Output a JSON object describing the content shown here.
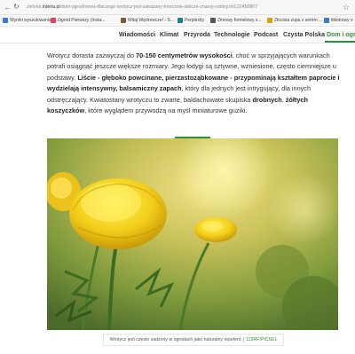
{
  "browser": {
    "url_prefix": "zielona.",
    "url_domain": "interia.pl",
    "url_path": "/dom-ogrod/news-dlaczego-wrotycz-jest-zakazany-mrocznie-oblicze-znanej-rosliny,nId,22450867"
  },
  "bookmarks": [
    {
      "label": "Wyniki wyszukiwania \"...",
      "color": "#3a7bd5"
    },
    {
      "label": "Ogród Pierwszy (Insta...",
      "color": "#e4405f"
    },
    {
      "label": "Witaj Wędrowcze! - S...",
      "color": "#7a5c3a"
    },
    {
      "label": "Perplexity",
      "color": "#20808d"
    },
    {
      "label": "Zimowy formelowy s...",
      "color": "#555555"
    },
    {
      "label": "Złocista zupa z serem ...",
      "color": "#d8a000"
    },
    {
      "label": "tiktokowy v",
      "color": "#3a7bd5"
    }
  ],
  "sitenav": {
    "items": [
      "Wiadomości",
      "Klimat",
      "Przyroda",
      "Technologie",
      "Podcast",
      "Czysta Polska",
      "Dom i ogr"
    ],
    "active_index": 6,
    "accent": "#2f8f3a"
  },
  "article": {
    "p1_a": "Wrotycz dorasta zazwyczaj do ",
    "p1_b": "70-150 centymetrów wysokości",
    "p1_c": ", choć w sprzyjających warunkach potrafi osiągnąć jeszcze większe rozmiary. Jego łodygi są sztywne, wzniesione, często ciemniejsze u podstawy. ",
    "p1_d": "Liście - głęboko powcinane, pierzastoząbkowane - przypominają kształtem paprocie i wydzielają intensywny, balsamiczny zapach",
    "p1_e": ", który dla jednych jest intrygujący, dla innych odstręczający. Kwiatostany wrotyczu to zwarte, baldachowate skupiska ",
    "p1_f": "drobnych",
    "p1_g": ", ",
    "p1_h": "żółtych koszyczków",
    "p1_i": ", które wyglądem przywodzą na myśl miniaturowe guziki."
  },
  "figure": {
    "caption": "Wrotycz jest często sadzony w ogrodach jako naturalny repelent.",
    "credit": "123RF/PICSEL"
  }
}
